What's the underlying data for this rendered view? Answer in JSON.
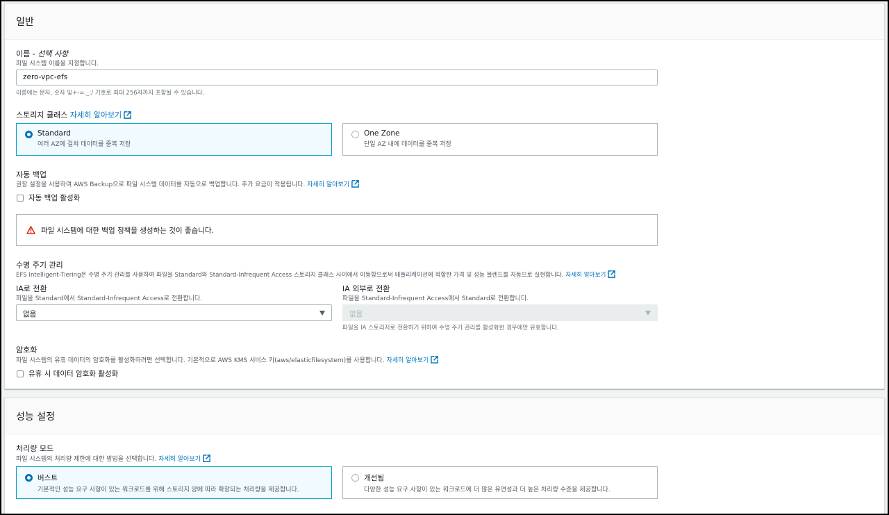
{
  "general": {
    "title": "일반",
    "name": {
      "label": "이름 - ",
      "optional": "선택 사항",
      "desc": "파일 시스템 이름을 지정합니다.",
      "value": "zero-vpc-efs",
      "hint": "이름에는 문자, 숫자 및+-=._:/ 기호로 최대 256자까지 포함될 수 있습니다."
    },
    "storage_class": {
      "label": "스토리지 클래스",
      "learn_more": "자세히 알아보기",
      "options": [
        {
          "title": "Standard",
          "desc": "여러 AZ에 걸쳐 데이터를 중복 저장",
          "selected": true
        },
        {
          "title": "One Zone",
          "desc": "단일 AZ 내에 데이터를 중복 저장",
          "selected": false
        }
      ]
    },
    "backup": {
      "label": "자동 백업",
      "desc": "권장 설정을 사용하여 AWS Backup으로 파일 시스템 데이터를 자동으로 백업합니다. 추가 요금이 적용됩니다.",
      "learn_more": "자세히 알아보기",
      "checkbox_label": "자동 백업 활성화",
      "checked": false,
      "warning": "파일 시스템에 대한 백업 정책을 생성하는 것이 좋습니다."
    },
    "lifecycle": {
      "label": "수명 주기 관리",
      "desc": "EFS Intelligent-Tiering은 수명 주기 관리를 사용하여 파일을 Standard와 Standard-Infrequent Access 스토리지 클래스 사이에서 이동함으로써 애플리케이션에 적합한 가격 및 성능 블렌드를 자동으로 실현합니다.",
      "learn_more": "자세히 알아보기",
      "to_ia": {
        "label": "IA로 전환",
        "desc": "파일을 Standard에서 Standard-Infrequent Access로 전환합니다.",
        "value": "없음"
      },
      "out_of_ia": {
        "label": "IA 외부로 전환",
        "desc": "파일을 Standard-Infrequent Access에서 Standard로 전환합니다.",
        "value": "없음",
        "hint": "파일을 IA 스토리지로 전환하기 위하여 수명 주기 관리를 활성화한 경우에만 유효합니다."
      }
    },
    "encryption": {
      "label": "암호화",
      "desc": "파일 시스템의 유휴 데이터의 암호화를 활성화하려면 선택합니다. 기본적으로 AWS KMS 서비스 키(aws/elasticfilesystem)를 사용합니다.",
      "learn_more": "자세히 알아보기",
      "checkbox_label": "유휴 시 데이터 암호화 활성화",
      "checked": false
    }
  },
  "performance": {
    "title": "성능 설정",
    "throughput": {
      "label": "처리량 모드",
      "desc": "파일 시스템의 처리량 제한에 대한 방법을 선택합니다.",
      "learn_more": "자세히 알아보기",
      "options": [
        {
          "title": "버스트",
          "desc": "기본적인 성능 요구 사항이 있는 워크로드를 위해 스토리지 양에 따라 확장되는 처리량을 제공합니다.",
          "selected": true
        },
        {
          "title": "개선됨",
          "desc": "다양한 성능 요구 사항이 있는 워크로드에 더 많은 유연성과 더 높은 처리량 수준을 제공합니다.",
          "selected": false
        }
      ]
    }
  },
  "colors": {
    "link": "#0073bb",
    "selected_border": "#00a1c9",
    "selected_bg": "#f1faff",
    "warning": "#d13212"
  }
}
